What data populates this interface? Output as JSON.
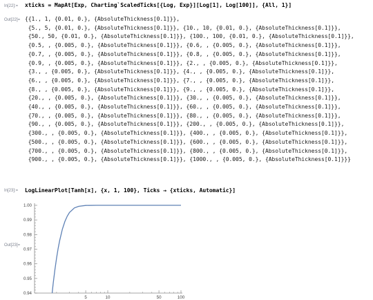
{
  "cell1": {
    "in_label": "In[22]:=",
    "out_label": "Out[22]=",
    "input": "xticks = MapAt[Exp, Charting`ScaledTicks[{Log, Exp}][Log[1], Log[100]], {All, 1}]",
    "output_lines": [
      "{{1., 1, {0.01, 0.}, {AbsoluteThickness[0.1]}},",
      " {5., 5, {0.01, 0.}, {AbsoluteThickness[0.1]}}, {10., 10, {0.01, 0.}, {AbsoluteThickness[0.1]}},",
      " {50., 50, {0.01, 0.}, {AbsoluteThickness[0.1]}}, {100., 100, {0.01, 0.}, {AbsoluteThickness[0.1]}},",
      " {0.5, , {0.005, 0.}, {AbsoluteThickness[0.1]}}, {0.6, , {0.005, 0.}, {AbsoluteThickness[0.1]}},",
      " {0.7, , {0.005, 0.}, {AbsoluteThickness[0.1]}}, {0.8, , {0.005, 0.}, {AbsoluteThickness[0.1]}},",
      " {0.9, , {0.005, 0.}, {AbsoluteThickness[0.1]}}, {2., , {0.005, 0.}, {AbsoluteThickness[0.1]}},",
      " {3., , {0.005, 0.}, {AbsoluteThickness[0.1]}}, {4., , {0.005, 0.}, {AbsoluteThickness[0.1]}},",
      " {6., , {0.005, 0.}, {AbsoluteThickness[0.1]}}, {7., , {0.005, 0.}, {AbsoluteThickness[0.1]}},",
      " {8., , {0.005, 0.}, {AbsoluteThickness[0.1]}}, {9., , {0.005, 0.}, {AbsoluteThickness[0.1]}},",
      " {20., , {0.005, 0.}, {AbsoluteThickness[0.1]}}, {30., , {0.005, 0.}, {AbsoluteThickness[0.1]}},",
      " {40., , {0.005, 0.}, {AbsoluteThickness[0.1]}}, {60., , {0.005, 0.}, {AbsoluteThickness[0.1]}},",
      " {70., , {0.005, 0.}, {AbsoluteThickness[0.1]}}, {80., , {0.005, 0.}, {AbsoluteThickness[0.1]}},",
      " {90., , {0.005, 0.}, {AbsoluteThickness[0.1]}}, {200., , {0.005, 0.}, {AbsoluteThickness[0.1]}},",
      " {300., , {0.005, 0.}, {AbsoluteThickness[0.1]}}, {400., , {0.005, 0.}, {AbsoluteThickness[0.1]}},",
      " {500., , {0.005, 0.}, {AbsoluteThickness[0.1]}}, {600., , {0.005, 0.}, {AbsoluteThickness[0.1]}},",
      " {700., , {0.005, 0.}, {AbsoluteThickness[0.1]}}, {800., , {0.005, 0.}, {AbsoluteThickness[0.1]}},",
      " {900., , {0.005, 0.}, {AbsoluteThickness[0.1]}}, {1000., , {0.005, 0.}, {AbsoluteThickness[0.1]}}}"
    ]
  },
  "cell2": {
    "in_label": "In[23]:=",
    "out_label": "Out[23]=",
    "input": "LogLinearPlot[Tanh[x], {x, 1, 100}, Ticks → {xticks, Automatic}]"
  },
  "chart_data": {
    "type": "line",
    "function": "Tanh[x]",
    "x_scale": "log",
    "xlim": [
      1,
      100
    ],
    "ylim": [
      0.94,
      1.0
    ],
    "x_ticks": [
      5,
      10,
      50,
      100
    ],
    "y_ticks": [
      0.94,
      0.95,
      0.96,
      0.97,
      0.98,
      0.99,
      1.0
    ],
    "y_tick_labels": [
      "0.94",
      "0.95",
      "0.96",
      "0.97",
      "0.98",
      "0.99",
      "1.00"
    ],
    "x_minor_ticks": [
      2,
      3,
      4,
      6,
      7,
      8,
      9,
      20,
      30,
      40,
      60,
      70,
      80,
      90
    ],
    "series": [
      {
        "x": [
          1,
          1.5,
          1.7,
          1.8,
          1.9,
          2,
          2.1,
          2.2,
          2.4,
          2.6,
          2.8,
          3,
          3.5,
          4,
          5,
          7,
          10,
          20,
          50,
          100
        ],
        "y": [
          0.7616,
          0.9051,
          0.9354,
          0.9468,
          0.9562,
          0.964,
          0.9705,
          0.9757,
          0.9837,
          0.989,
          0.9926,
          0.9951,
          0.9982,
          0.9993,
          0.9999,
          1.0,
          1.0,
          1.0,
          1.0,
          1.0
        ]
      }
    ],
    "colors": {
      "curve": "#5e81b5",
      "axis": "#888888"
    }
  }
}
